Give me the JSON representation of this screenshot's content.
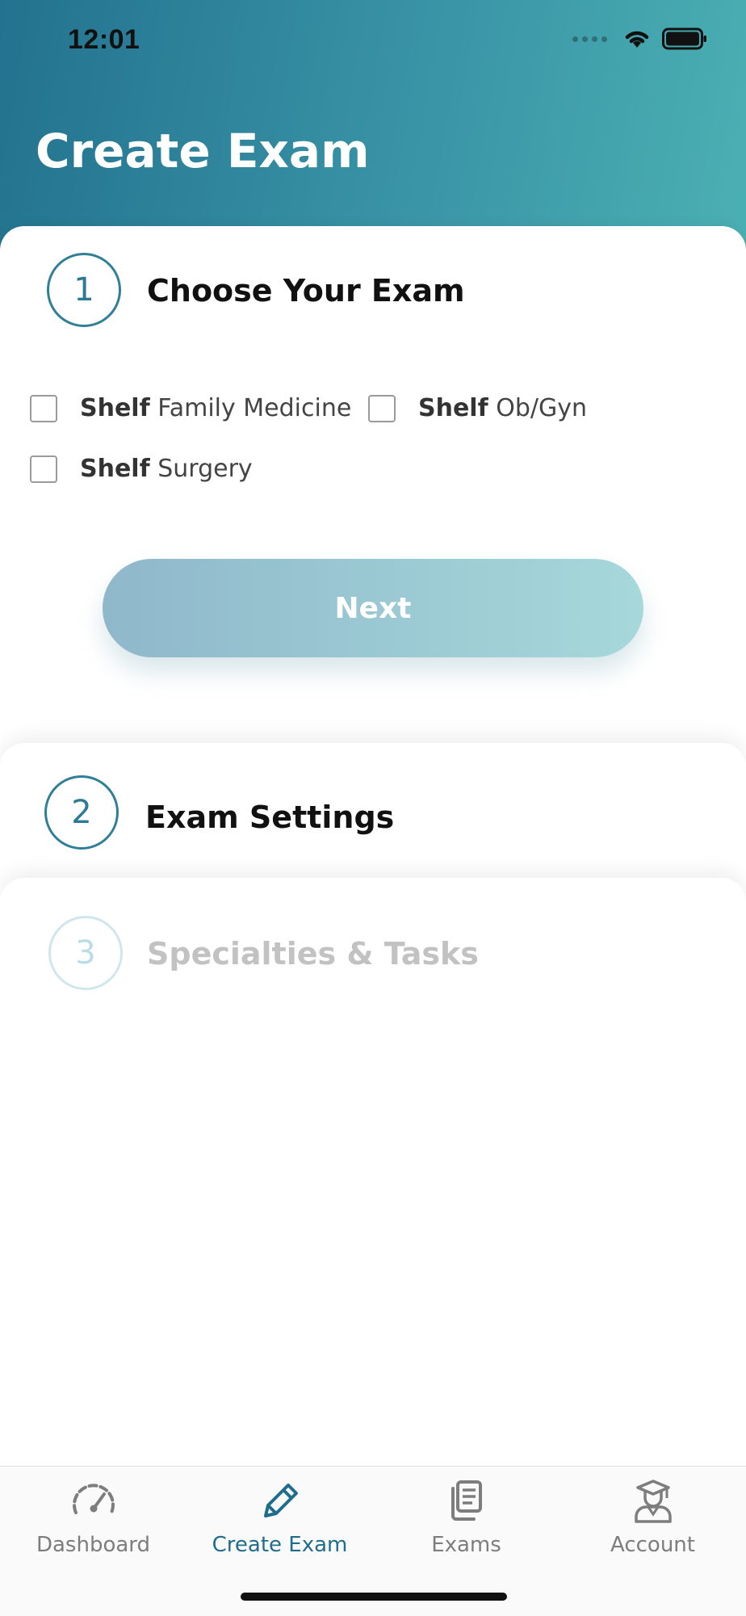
{
  "status_bar": {
    "time": "12:01"
  },
  "header": {
    "title": "Create Exam"
  },
  "steps": [
    {
      "number": "1",
      "title": "Choose Your Exam"
    },
    {
      "number": "2",
      "title": "Exam Settings"
    },
    {
      "number": "3",
      "title": "Specialties & Tasks"
    }
  ],
  "exam_options": [
    {
      "prefix": "Shelf",
      "name": "Family Medicine",
      "checked": false
    },
    {
      "prefix": "Shelf",
      "name": "Ob/Gyn",
      "checked": false
    },
    {
      "prefix": "Shelf",
      "name": "Surgery",
      "checked": false
    }
  ],
  "next_button": {
    "label": "Next"
  },
  "tabs": [
    {
      "label": "Dashboard",
      "icon": "speedometer-icon",
      "active": false
    },
    {
      "label": "Create Exam",
      "icon": "pencil-icon",
      "active": true
    },
    {
      "label": "Exams",
      "icon": "documents-icon",
      "active": false
    },
    {
      "label": "Account",
      "icon": "graduate-user-icon",
      "active": false
    }
  ],
  "colors": {
    "header_gradient_start": "#23728f",
    "header_gradient_end": "#4bb0b3",
    "accent": "#1f6d8d",
    "next_button_start": "#8fb8cb",
    "next_button_end": "#a6d8da"
  }
}
